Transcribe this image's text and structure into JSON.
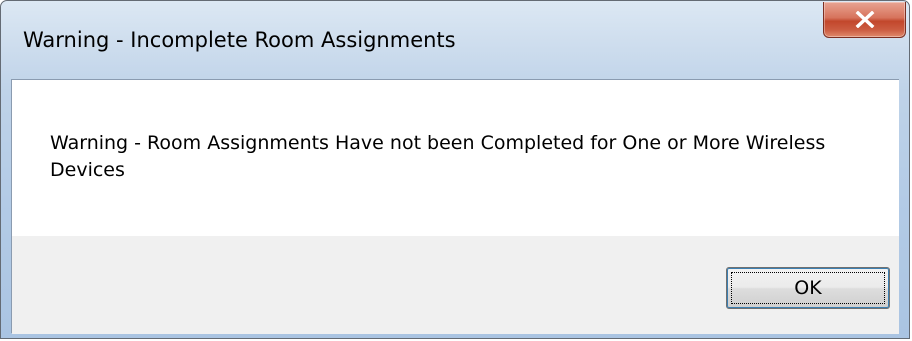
{
  "window": {
    "title": "Warning - Incomplete Room Assignments",
    "close_icon": "close-x-icon"
  },
  "dialog": {
    "message": "Warning - Room Assignments Have not been Completed for One or More Wireless Devices",
    "ok_label": "OK"
  },
  "colors": {
    "close_button": "#c9543a",
    "frame": "#b3cbe6",
    "footer": "#f0f0f0"
  }
}
